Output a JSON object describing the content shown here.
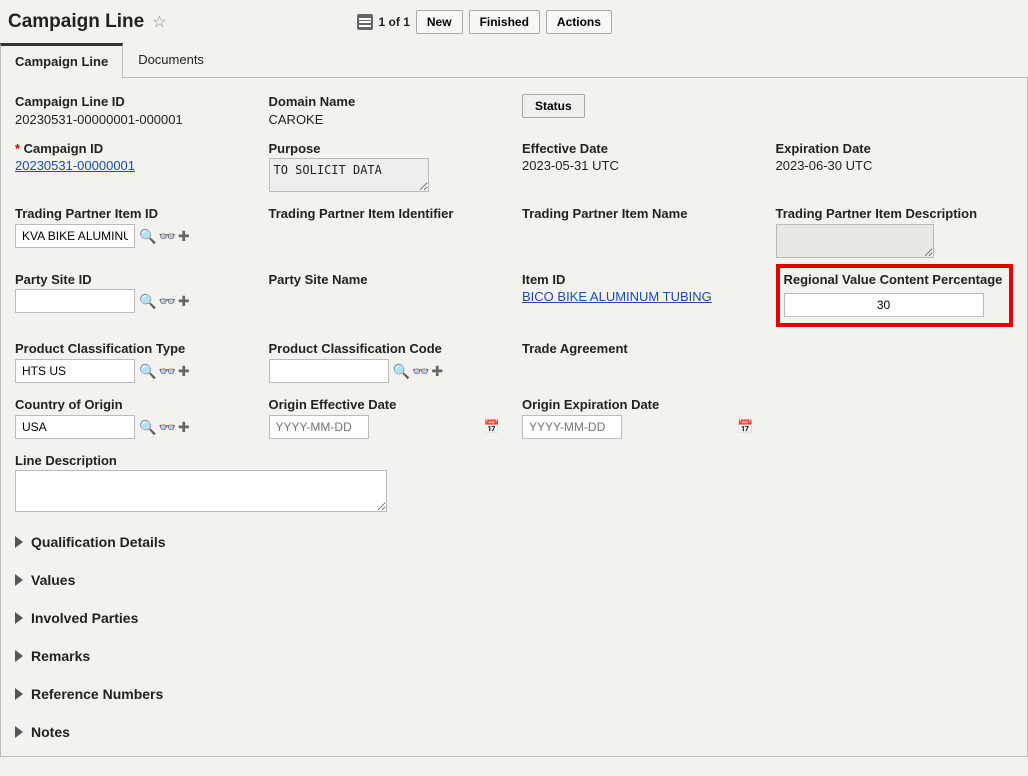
{
  "header": {
    "title": "Campaign Line",
    "counter": "1 of 1",
    "buttons": {
      "new": "New",
      "finished": "Finished",
      "actions": "Actions"
    }
  },
  "tabs": {
    "campaign_line": "Campaign Line",
    "documents": "Documents"
  },
  "fields": {
    "campaign_line_id": {
      "label": "Campaign Line ID",
      "value": "20230531-00000001-000001"
    },
    "domain_name": {
      "label": "Domain Name",
      "value": "CAROKE"
    },
    "status_btn": "Status",
    "campaign_id": {
      "label": "Campaign ID",
      "value": "20230531-00000001"
    },
    "purpose": {
      "label": "Purpose",
      "value": "TO SOLICIT DATA"
    },
    "effective_date": {
      "label": "Effective Date",
      "value": "2023-05-31 UTC"
    },
    "expiration_date": {
      "label": "Expiration Date",
      "value": "2023-06-30 UTC"
    },
    "tp_item_id": {
      "label": "Trading Partner Item ID",
      "value": "KVA BIKE ALUMINU"
    },
    "tp_item_identifier": {
      "label": "Trading Partner Item Identifier"
    },
    "tp_item_name": {
      "label": "Trading Partner Item Name"
    },
    "tp_item_description": {
      "label": "Trading Partner Item Description"
    },
    "party_site_id": {
      "label": "Party Site ID",
      "value": ""
    },
    "party_site_name": {
      "label": "Party Site Name"
    },
    "item_id": {
      "label": "Item ID",
      "value": "BICO BIKE ALUMINUM TUBING"
    },
    "rvc": {
      "label": "Regional Value Content Percentage",
      "value": "30"
    },
    "product_class_type": {
      "label": "Product Classification Type",
      "value": "HTS US"
    },
    "product_class_code": {
      "label": "Product Classification Code",
      "value": ""
    },
    "trade_agreement": {
      "label": "Trade Agreement"
    },
    "country_of_origin": {
      "label": "Country of Origin",
      "value": "USA"
    },
    "origin_effective_date": {
      "label": "Origin Effective Date",
      "placeholder": "YYYY-MM-DD"
    },
    "origin_expiration_date": {
      "label": "Origin Expiration Date",
      "placeholder": "YYYY-MM-DD"
    },
    "line_description": {
      "label": "Line Description",
      "value": ""
    }
  },
  "sections": {
    "qualification_details": "Qualification Details",
    "values": "Values",
    "involved_parties": "Involved Parties",
    "remarks": "Remarks",
    "reference_numbers": "Reference Numbers",
    "notes": "Notes"
  }
}
